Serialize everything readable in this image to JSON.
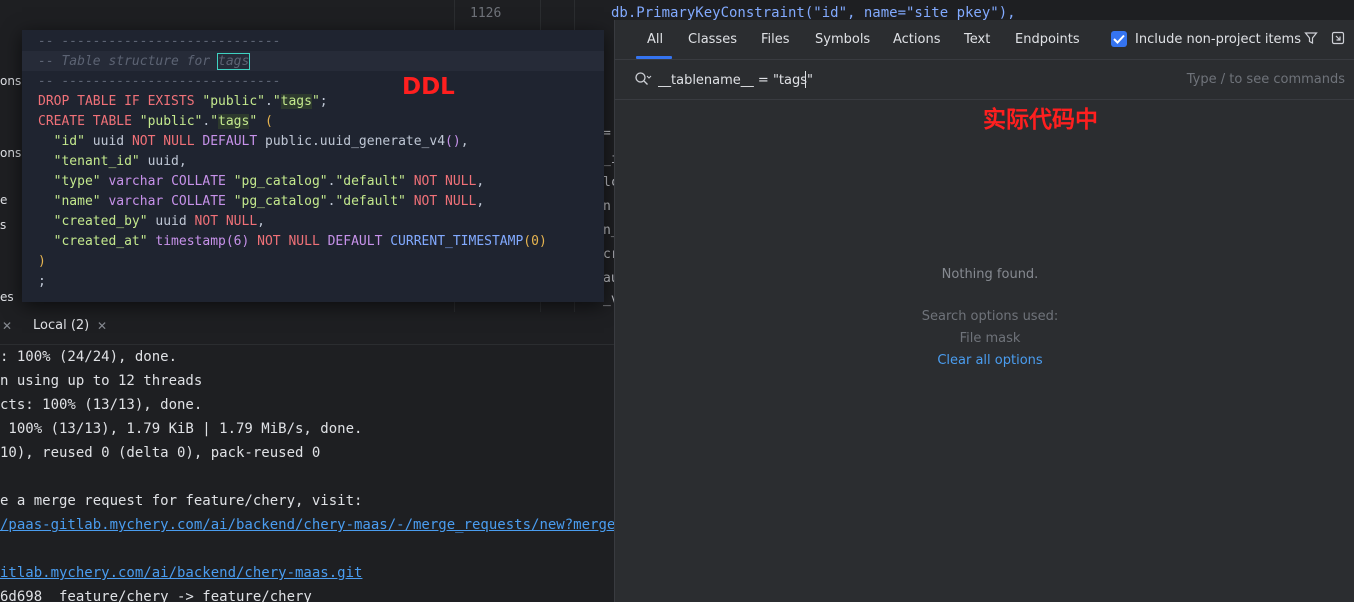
{
  "background_editor": {
    "line_number": "1126",
    "code_fragment_top": "db.PrimaryKeyConstraint(\"id\", name=\"site_pkey\"),",
    "left_panel_fragments": [
      "ons",
      "ons",
      "e",
      "s",
      "es"
    ],
    "right_gutter_fragments": [
      "=",
      "_i",
      "lc",
      "n",
      "n_",
      "cr",
      "au",
      "_v"
    ]
  },
  "ddl_popup": {
    "annotation_label": "DDL",
    "lines": [
      "-- ----------------------------",
      "-- Table structure for tags",
      "-- ----------------------------",
      "DROP TABLE IF EXISTS \"public\".\"tags\";",
      "CREATE TABLE \"public\".\"tags\" (",
      "  \"id\" uuid NOT NULL DEFAULT public.uuid_generate_v4(),",
      "  \"tenant_id\" uuid,",
      "  \"type\" varchar COLLATE \"pg_catalog\".\"default\" NOT NULL,",
      "  \"name\" varchar COLLATE \"pg_catalog\".\"default\" NOT NULL,",
      "  \"created_by\" uuid NOT NULL,",
      "  \"created_at\" timestamp(6) NOT NULL DEFAULT CURRENT_TIMESTAMP(0)",
      ")",
      ";"
    ]
  },
  "terminal": {
    "tab_label": "Local (2)",
    "lines": [
      ": 100% (24/24), done.",
      "n using up to 12 threads",
      "cts: 100% (13/13), done.",
      " 100% (13/13), 1.79 KiB | 1.79 MiB/s, done.",
      "10), reused 0 (delta 0), pack-reused 0",
      "",
      "e a merge request for feature/chery, visit:",
      "/paas-gitlab.mychery.com/ai/backend/chery-maas/-/merge_requests/new?merge_requ",
      "",
      "itlab.mychery.com/ai/backend/chery-maas.git",
      "6d698  feature/chery -> feature/chery"
    ]
  },
  "search_popup": {
    "tabs": [
      "All",
      "Classes",
      "Files",
      "Symbols",
      "Actions",
      "Text",
      "Endpoints"
    ],
    "active_tab": "All",
    "include_non_project_label": "Include non-project items",
    "include_non_project_checked": true,
    "query": "__tablename__ = \"tags\"",
    "hint": "Type / to see commands",
    "annotation_label": "实际代码中",
    "empty_message": "Nothing found.",
    "options_used_label": "Search options used:",
    "option_file_mask": "File mask",
    "clear_options_label": "Clear all options"
  },
  "colors": {
    "accent": "#3574f0",
    "annotation_red": "#ff1f1f",
    "link": "#4a9df0"
  }
}
